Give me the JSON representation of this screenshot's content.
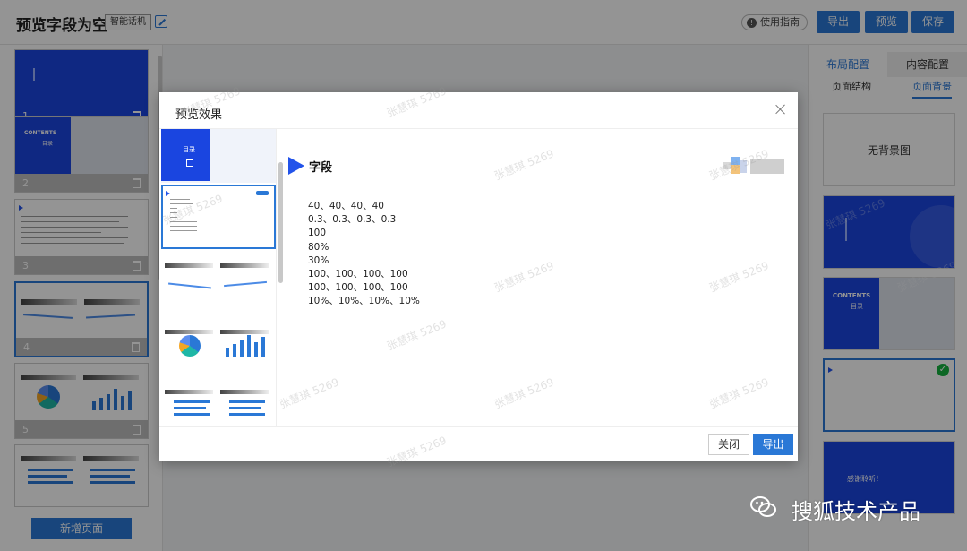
{
  "header": {
    "title": "预览字段为空",
    "tag": "智能话机",
    "guide_label": "使用指南",
    "buttons": {
      "export": "导出",
      "preview": "预览",
      "save": "保存"
    }
  },
  "left_panel": {
    "pages": [
      "1",
      "2",
      "3",
      "4",
      "5"
    ],
    "page2_text": {
      "title": "CONTENTS",
      "subtitle": "目录"
    },
    "add_page_label": "新增页面"
  },
  "right_panel": {
    "tabs": [
      "布局配置",
      "内容配置"
    ],
    "subtabs": [
      "页面结构",
      "页面背景"
    ],
    "no_background_label": "无背景图",
    "bg2_text": {
      "title": "CONTENTS",
      "subtitle": "目录"
    },
    "bg4_text": "感谢聆听！"
  },
  "modal": {
    "title": "预览效果",
    "thumb_list_text": {
      "subtitle": "目录"
    },
    "slide": {
      "heading": "字段",
      "lines": [
        "40、40、40、40",
        "0.3、0.3、0.3、0.3",
        "100",
        "80%",
        "30%",
        "100、100、100、100",
        "100、100、100、100",
        "10%、10%、10%、10%"
      ]
    },
    "close_label": "关闭",
    "export_label": "导出"
  },
  "watermark_text": "张慧琪 5269",
  "brand_text": "搜狐技术产品",
  "colors": {
    "accent": "#2a78d6",
    "slide_blue": "#1a45e0",
    "check_green": "#16b13f"
  }
}
